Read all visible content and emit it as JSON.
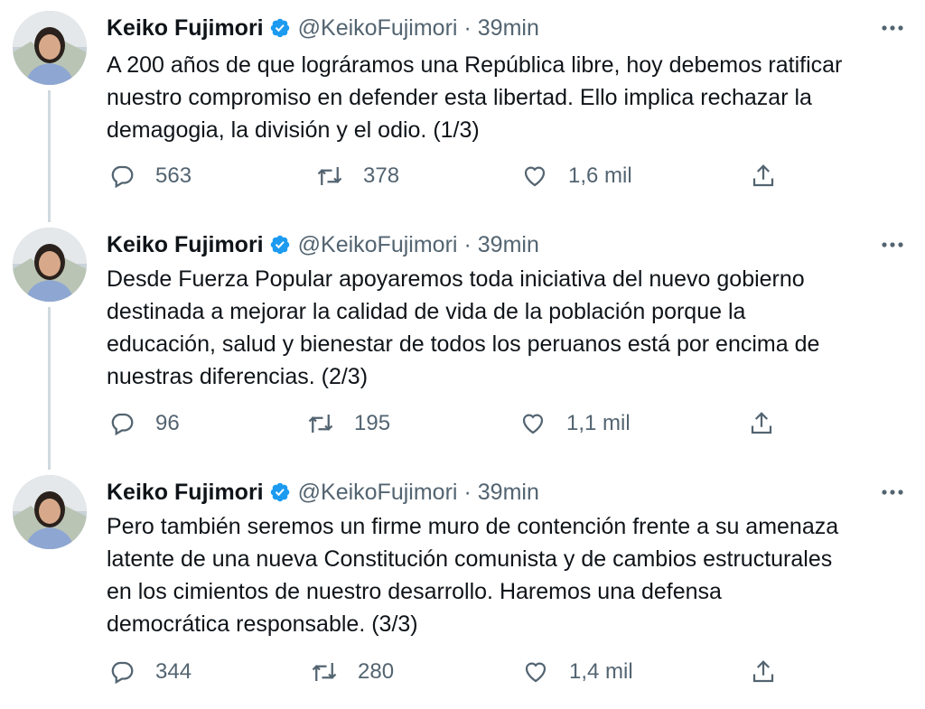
{
  "colors": {
    "text_primary": "#0f1419",
    "text_secondary": "#536471",
    "verified_blue": "#1d9bf0",
    "thread_line": "#cfd9de"
  },
  "tweets": [
    {
      "author_name": "Keiko Fujimori",
      "handle": "@KeikoFujimori",
      "separator": "·",
      "time": "39min",
      "text_lines": [
        "A 200 años de que lográramos una República libre, hoy debemos ratificar",
        "nuestro compromiso en defender esta libertad. Ello implica rechazar la",
        "demagogia, la división y el odio. (1/3)"
      ],
      "replies": "563",
      "retweets": "378",
      "likes": "1,6 mil"
    },
    {
      "author_name": "Keiko Fujimori",
      "handle": "@KeikoFujimori",
      "separator": "·",
      "time": "39min",
      "text_lines": [
        "Desde Fuerza Popular apoyaremos toda iniciativa del nuevo gobierno",
        "destinada a mejorar la calidad de vida de la población porque la",
        "educación, salud y bienestar de todos los peruanos está por encima de",
        "nuestras diferencias. (2/3)"
      ],
      "replies": "96",
      "retweets": "195",
      "likes": "1,1 mil"
    },
    {
      "author_name": "Keiko Fujimori",
      "handle": "@KeikoFujimori",
      "separator": "·",
      "time": "39min",
      "text_lines": [
        "Pero también seremos un firme muro de contención frente a su amenaza",
        "latente de una nueva Constitución comunista y de cambios estructurales",
        "en los cimientos de nuestro desarrollo. Haremos una defensa",
        "democrática responsable. (3/3)"
      ],
      "replies": "344",
      "retweets": "280",
      "likes": "1,4 mil"
    }
  ],
  "icons": {
    "reply": "reply-icon",
    "retweet": "retweet-icon",
    "like": "heart-icon",
    "share": "share-icon",
    "more": "more-icon",
    "verified": "verified-badge-icon"
  }
}
